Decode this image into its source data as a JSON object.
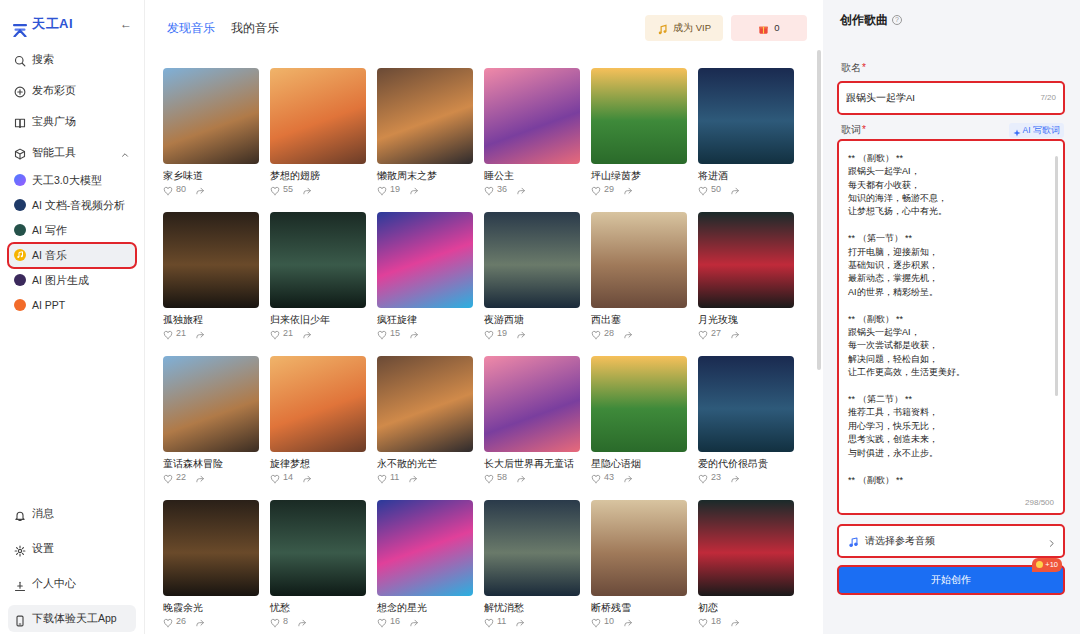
{
  "logo": {
    "text": "天工AI",
    "collapse": "←"
  },
  "sidebar": {
    "nav": [
      {
        "label": "搜索",
        "selected": false
      },
      {
        "label": "发布彩页",
        "selected": false
      },
      {
        "label": "宝典广场",
        "selected": false
      }
    ],
    "group": {
      "label": "智能工具",
      "expanded": true,
      "items": [
        {
          "label": "天工3.0大模型",
          "selected": false
        },
        {
          "label": "AI 文档-音视频分析",
          "selected": false
        },
        {
          "label": "AI 写作",
          "selected": false
        },
        {
          "label": "AI 音乐",
          "selected": true
        },
        {
          "label": "AI 图片生成",
          "selected": false
        },
        {
          "label": "AI PPT",
          "selected": false
        }
      ]
    },
    "bottom": [
      {
        "label": "消息"
      },
      {
        "label": "设置"
      },
      {
        "label": "个人中心"
      }
    ],
    "download": {
      "label": "下载体验天工App"
    }
  },
  "tabs": [
    {
      "label": "发现音乐",
      "selected": true
    },
    {
      "label": "我的音乐",
      "selected": false
    }
  ],
  "header": {
    "vip": "成为 VIP",
    "points": "0"
  },
  "songs": [
    {
      "title": "家乡味道",
      "likes": "80"
    },
    {
      "title": "梦想的翅膀",
      "likes": "55"
    },
    {
      "title": "懒散周末之梦",
      "likes": "19"
    },
    {
      "title": "睡公主",
      "likes": "36"
    },
    {
      "title": "坪山绿茵梦",
      "likes": "29"
    },
    {
      "title": "将进酒",
      "likes": "50"
    },
    {
      "title": "孤独旅程",
      "likes": "21"
    },
    {
      "title": "归来依旧少年",
      "likes": "21"
    },
    {
      "title": "疯狂旋律",
      "likes": "15"
    },
    {
      "title": "夜游西塘",
      "likes": "19"
    },
    {
      "title": "西出塞",
      "likes": "28"
    },
    {
      "title": "月光玫瑰",
      "likes": "27"
    },
    {
      "title": "童话森林冒险",
      "likes": "22"
    },
    {
      "title": "旋律梦想",
      "likes": "14"
    },
    {
      "title": "永不散的光芒",
      "likes": "11"
    },
    {
      "title": "长大后世界再无童话",
      "likes": "58"
    },
    {
      "title": "星隐心语烟",
      "likes": "43"
    },
    {
      "title": "爱的代价很昂贵",
      "likes": "23"
    },
    {
      "title": "晚霞余光",
      "likes": "26"
    },
    {
      "title": "忧愁",
      "likes": "8"
    },
    {
      "title": "想念的星光",
      "likes": "16"
    },
    {
      "title": "解忧消愁",
      "likes": "11"
    },
    {
      "title": "断桥残雪",
      "likes": "10"
    },
    {
      "title": "初恋",
      "likes": "18"
    }
  ],
  "panel": {
    "title": "创作歌曲",
    "help": "?",
    "song_name": {
      "label": "歌名",
      "required": "*",
      "value": "跟锅头一起学AI",
      "counter": "7/20"
    },
    "lyrics": {
      "label": "歌词",
      "required": "*",
      "ai_button": "AI 写歌词",
      "text": "** （副歌） **\n跟锅头一起学AI，\n每天都有小收获，\n知识的海洋，畅游不息，\n让梦想飞扬，心中有光。\n\n** （第一节） **\n打开电脑，迎接新知，\n基础知识，逐步积累，\n最新动态，掌握先机，\nAI的世界，精彩纷呈。\n\n** （副歌） **\n跟锅头一起学AI，\n每一次尝试都是收获，\n解决问题，轻松自如，\n让工作更高效，生活更美好。\n\n** （第二节） **\n推荐工具，书籍资料，\n用心学习，快乐无比，\n思考实践，创造未来，\n与时俱进，永不止步。\n\n** （副歌） **",
      "counter": "298/500"
    },
    "reference": {
      "label": "请选择参考音频"
    },
    "submit": {
      "label": "开始创作",
      "badge": "+10"
    }
  }
}
